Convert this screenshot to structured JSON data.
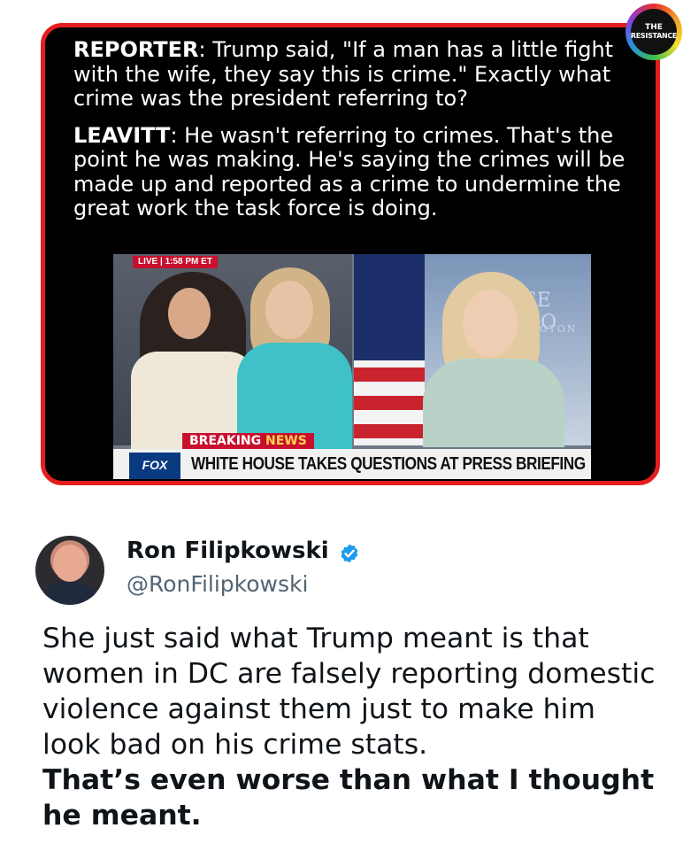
{
  "quote_card": {
    "reporter_label": "REPORTER",
    "reporter_text": ": Trump said, \"If a man has a little fight with the wife, they say this is crime.\" Exactly what crime was the president referring to?",
    "leavitt_label": "LEAVITT",
    "leavitt_text": ": He wasn't referring to crimes. That's the point he was making. He's saying the crimes will be made up and reported as a crime to undermine the great work the task force is doing."
  },
  "tv_screenshot": {
    "live_tag": "LIVE | 1:58 PM ET",
    "breaking_label": "BREAKING",
    "breaking_news": "NEWS",
    "network_logo": "FOX NEWS",
    "headline": "WHITE HOUSE TAKES QUESTIONS AT PRESS BRIEFING",
    "background_sign": "TE HO",
    "background_sign_2": "NGTON"
  },
  "badge": {
    "line1": "THE",
    "line2": "RESISTANCE"
  },
  "tweet": {
    "display_name": "Ron Filipkowski",
    "handle": "@RonFilipkowski",
    "verified_icon": "verified-badge-icon",
    "body": "She just said what Trump meant is that women in DC are falsely reporting domestic violence against them just to make him look bad on his crime stats.",
    "emphasis": "That’s even worse than what I thought he meant."
  },
  "colors": {
    "card_border": "#e41e1e",
    "verified": "#1d9bf0",
    "handle": "#536471"
  }
}
